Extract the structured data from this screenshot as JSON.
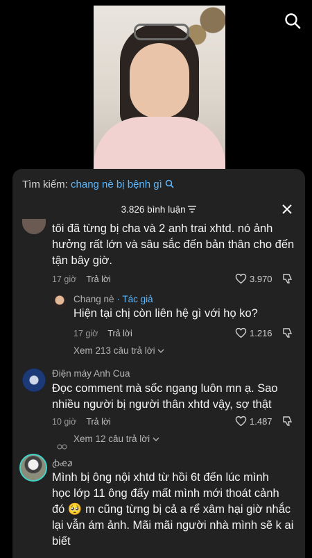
{
  "search_bar": {
    "prefix": "Tìm kiếm:",
    "query": "chang nè bị bệnh gì"
  },
  "comments_header": {
    "count": "3.826 bình luận"
  },
  "comment1": {
    "lines": [
      "tôi đã từng bị cha và 2 anh trai xhtd. nó ảnh",
      "hưởng rất lớn và sâu sắc đến bản thân cho đến",
      "tận bây giờ."
    ],
    "time": "17 giờ",
    "reply_label": "Trả lời",
    "likes": "3.970"
  },
  "reply1": {
    "author": "Chang nè",
    "badge": "· Tác giả",
    "text": "Hiện tại chị còn liên hệ gì với họ ko?",
    "time": "17 giờ",
    "reply_label": "Trả lời",
    "likes": "1.216",
    "more": "Xem 213 câu trả lời"
  },
  "comment2": {
    "author": "Điện máy Anh Cua",
    "lines": [
      "Đọc comment mà sốc ngang luôn mn ạ. Sao",
      "nhiều người bị người thân xhtd vậy, sợ thật"
    ],
    "time": "10 giờ",
    "reply_label": "Trả lời",
    "likes": "1.487",
    "more": "Xem 12 câu trả lời"
  },
  "comment3": {
    "author": "ꞗꬴꬿ",
    "lines": [
      "Mình bị ông nội xhtd từ hồi 6t đến lúc mình",
      "học lớp 11 ông đấy mất mình mới thoát cảnh",
      "đó 🥺 m cũng từng bị cả a rể xâm hại giờ nhắc",
      "lại vẫn ám ảnh. Mãi mãi người nhà mình sẽ k ai",
      "biết"
    ]
  },
  "colors": {
    "panel": "#222222",
    "accent": "#5cb8ff"
  }
}
